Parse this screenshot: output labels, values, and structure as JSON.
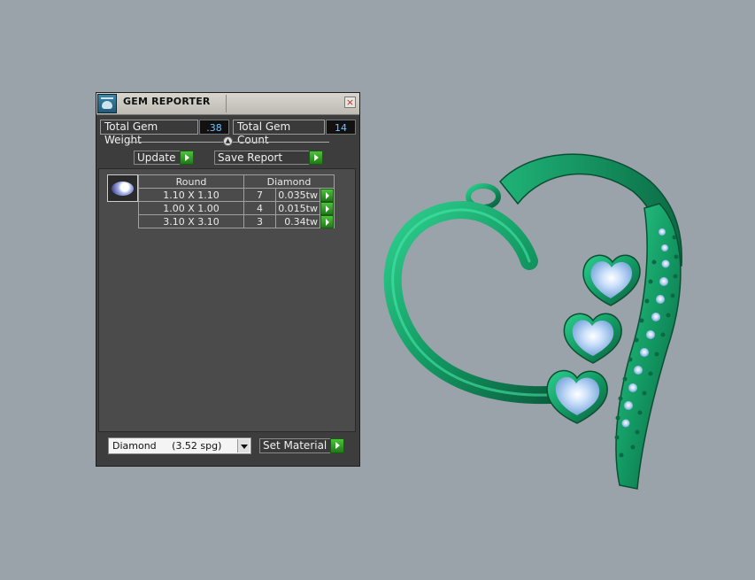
{
  "panel": {
    "title": "GEM REPORTER",
    "close_label": "×",
    "total_weight_label": "Total Gem Weight",
    "total_weight_value": ".38",
    "total_count_label": "Total Gem Count",
    "total_count_value": "14",
    "update_label": "Update",
    "save_report_label": "Save Report",
    "table": {
      "headers": [
        "Round",
        "Diamond"
      ],
      "rows": [
        {
          "size": "1.10 X 1.10",
          "count": "7",
          "weight": "0.035tw"
        },
        {
          "size": "1.00 X 1.00",
          "count": "4",
          "weight": "0.015tw"
        },
        {
          "size": "3.10 X 3.10",
          "count": "3",
          "weight": "0.34tw"
        }
      ]
    },
    "material_select": "Diamond     (3.52 spg)",
    "set_material_label": "Set Material"
  },
  "icons": {
    "logo": "gem-reporter-logo-icon",
    "close": "close-icon",
    "arrow": "green-arrow-icon",
    "gem": "round-gem-icon",
    "dropdown": "chevron-down-icon"
  },
  "colors": {
    "background": "#9aa2aa",
    "panel": "#3d3d3d",
    "accent_green": "#2fa320",
    "value_text": "#6ec6ff",
    "model_metal": "#1f9a6c",
    "model_gem": "#a8ccf2"
  }
}
